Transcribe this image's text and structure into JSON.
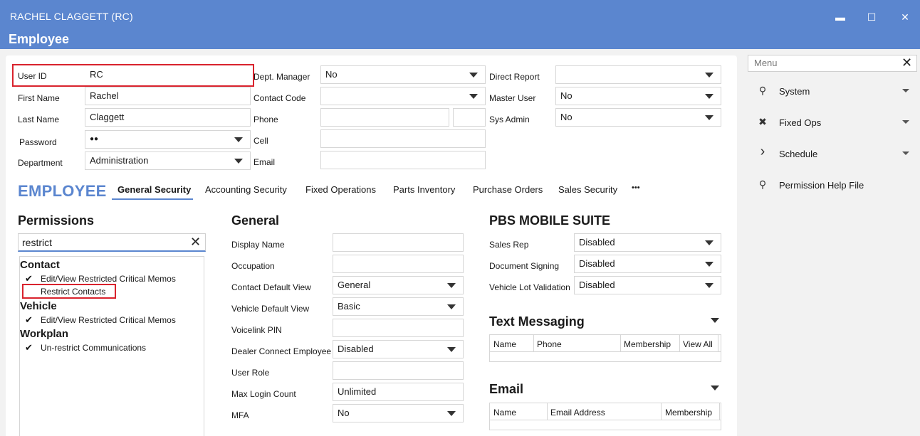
{
  "window": {
    "title": "RACHEL CLAGGETT (RC)",
    "heading": "Employee",
    "min_glyph": "▬",
    "max_glyph": "☐",
    "close_glyph": "✕"
  },
  "profile": {
    "user_id": {
      "label": "User ID",
      "value": "RC"
    },
    "first_name": {
      "label": "First Name",
      "value": "Rachel"
    },
    "last_name": {
      "label": "Last Name",
      "value": "Claggett"
    },
    "password": {
      "label": "Password",
      "value": "●●"
    },
    "department": {
      "label": "Department",
      "value": "Administration"
    },
    "dept_manager": {
      "label": "Dept. Manager",
      "value": "No"
    },
    "contact_code": {
      "label": "Contact Code",
      "value": ""
    },
    "phone": {
      "label": "Phone",
      "value": "",
      "ext": ""
    },
    "cell": {
      "label": "Cell",
      "value": ""
    },
    "email": {
      "label": "Email",
      "value": ""
    },
    "direct_report": {
      "label": "Direct Report",
      "value": ""
    },
    "master_user": {
      "label": "Master User",
      "value": "No"
    },
    "sys_admin": {
      "label": "Sys Admin",
      "value": "No"
    }
  },
  "section_title": "EMPLOYEE",
  "tabs": [
    "General Security",
    "Accounting Security",
    "Fixed Operations",
    "Parts Inventory",
    "Purchase Orders",
    "Sales Security"
  ],
  "tabs_more": "•••",
  "permissions": {
    "title": "Permissions",
    "search_value": "restrict",
    "clear_glyph": "✕",
    "check_glyph": "✔",
    "groups": [
      {
        "name": "Contact",
        "items": [
          {
            "label": "Edit/View Restricted Critical Memos",
            "checked": true
          },
          {
            "label": "Restrict Contacts",
            "checked": false
          }
        ]
      },
      {
        "name": "Vehicle",
        "items": [
          {
            "label": "Edit/View Restricted Critical Memos",
            "checked": true
          }
        ]
      },
      {
        "name": "Workplan",
        "items": [
          {
            "label": "Un-restrict Communications",
            "checked": true
          }
        ]
      }
    ]
  },
  "general": {
    "title": "General",
    "display_name": {
      "label": "Display Name",
      "value": ""
    },
    "occupation": {
      "label": "Occupation",
      "value": ""
    },
    "contact_default_view": {
      "label": "Contact Default View",
      "value": "General"
    },
    "vehicle_default_view": {
      "label": "Vehicle Default View",
      "value": "Basic"
    },
    "voicelink_pin": {
      "label": "Voicelink PIN",
      "value": ""
    },
    "dealer_connect_employee": {
      "label": "Dealer Connect Employee",
      "value": "Disabled"
    },
    "user_role": {
      "label": "User Role",
      "value": ""
    },
    "max_login_count": {
      "label": "Max Login Count",
      "value": "Unlimited"
    },
    "mfa": {
      "label": "MFA",
      "value": "No"
    }
  },
  "mobile_suite": {
    "title": "PBS MOBILE SUITE",
    "sales_rep": {
      "label": "Sales Rep",
      "value": "Disabled"
    },
    "document_signing": {
      "label": "Document Signing",
      "value": "Disabled"
    },
    "vehicle_lot_validation": {
      "label": "Vehicle Lot Validation",
      "value": "Disabled"
    }
  },
  "text_messaging": {
    "title": "Text Messaging",
    "columns": [
      "Name",
      "Phone",
      "Membership",
      "View All"
    ]
  },
  "email_section": {
    "title": "Email",
    "columns": [
      "Name",
      "Email Address",
      "Membership"
    ]
  },
  "side_menu": {
    "search_placeholder": "Menu",
    "clear_glyph": "✕",
    "items": [
      {
        "label": "System",
        "icon": "user-key-icon",
        "glyph": "⚲"
      },
      {
        "label": "Fixed Ops",
        "icon": "tools-icon",
        "glyph": "✖"
      },
      {
        "label": "Schedule",
        "icon": "chevron-right-icon",
        "glyph": "›"
      },
      {
        "label": "Permission Help File",
        "icon": "user-key-icon",
        "glyph": "⚲"
      }
    ]
  }
}
